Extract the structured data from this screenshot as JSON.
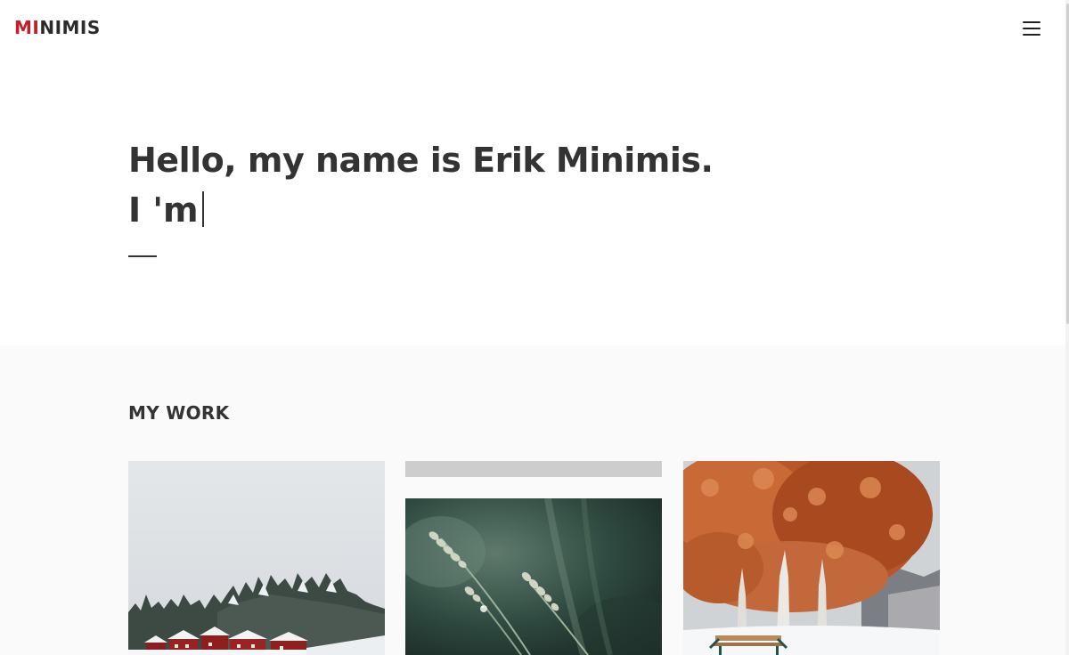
{
  "header": {
    "logo_accent": "MI",
    "logo_rest": "NIMIS",
    "menu_icon": "hamburger-menu-icon"
  },
  "hero": {
    "line1": "Hello, my name is Erik Minimis.",
    "line2": "I 'm"
  },
  "work": {
    "title": "MY WORK",
    "items": [
      {
        "image": "snowy-village-with-red-houses"
      },
      {
        "image": "grass-seed-heads-with-water-drop"
      },
      {
        "image": "orange-autumn-tree-with-snowy-bench"
      }
    ]
  },
  "colors": {
    "accent": "#c0202a",
    "text": "#333333",
    "section_bg": "#fafafa"
  }
}
